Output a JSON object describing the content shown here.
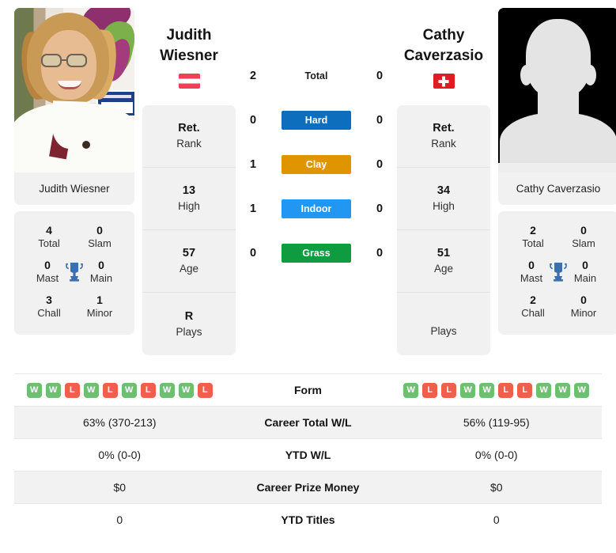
{
  "players": {
    "left": {
      "first_name": "Judith",
      "last_name": "Wiesner",
      "full_name": "Judith Wiesner",
      "flag": "austria-flag",
      "photo": "player-photo",
      "rank": {
        "rank_value": "Ret.",
        "rank_label": "Rank",
        "high_value": "13",
        "high_label": "High",
        "age_value": "57",
        "age_label": "Age",
        "plays_value": "R",
        "plays_label": "Plays"
      },
      "titles": {
        "total_value": "4",
        "total_label": "Total",
        "slam_value": "0",
        "slam_label": "Slam",
        "mast_value": "0",
        "mast_label": "Mast",
        "main_value": "0",
        "main_label": "Main",
        "chall_value": "3",
        "chall_label": "Chall",
        "minor_value": "1",
        "minor_label": "Minor"
      },
      "form": [
        "W",
        "W",
        "L",
        "W",
        "L",
        "W",
        "L",
        "W",
        "W",
        "L"
      ],
      "career_total_wl": "63% (370-213)",
      "ytd_wl": "0% (0-0)",
      "career_prize_money": "$0",
      "ytd_titles": "0"
    },
    "right": {
      "first_name": "Cathy",
      "last_name": "Caverzasio",
      "full_name": "Cathy Caverzasio",
      "flag": "switzerland-flag",
      "photo": "player-photo-placeholder",
      "rank": {
        "rank_value": "Ret.",
        "rank_label": "Rank",
        "high_value": "34",
        "high_label": "High",
        "age_value": "51",
        "age_label": "Age",
        "plays_value": "",
        "plays_label": "Plays"
      },
      "titles": {
        "total_value": "2",
        "total_label": "Total",
        "slam_value": "0",
        "slam_label": "Slam",
        "mast_value": "0",
        "mast_label": "Mast",
        "main_value": "0",
        "main_label": "Main",
        "chall_value": "2",
        "chall_label": "Chall",
        "minor_value": "0",
        "minor_label": "Minor"
      },
      "form": [
        "W",
        "L",
        "L",
        "W",
        "W",
        "L",
        "L",
        "W",
        "W",
        "W"
      ],
      "career_total_wl": "56% (119-95)",
      "ytd_wl": "0% (0-0)",
      "career_prize_money": "$0",
      "ytd_titles": "0"
    }
  },
  "head_to_head": {
    "rows": [
      {
        "label": "Total",
        "left": "2",
        "right": "0",
        "style": "plain",
        "color": ""
      },
      {
        "label": "Hard",
        "left": "0",
        "right": "0",
        "style": "pill",
        "color": "#0d6ebd"
      },
      {
        "label": "Clay",
        "left": "1",
        "right": "0",
        "style": "pill",
        "color": "#e09400"
      },
      {
        "label": "Indoor",
        "left": "1",
        "right": "0",
        "style": "pill",
        "color": "#2196f3"
      },
      {
        "label": "Grass",
        "left": "0",
        "right": "0",
        "style": "pill",
        "color": "#0f9b3f"
      }
    ]
  },
  "comparison_table": {
    "rows": [
      {
        "label": "Form",
        "type": "form"
      },
      {
        "label": "Career Total W/L",
        "type": "text",
        "left_key": "career_total_wl",
        "right_key": "career_total_wl"
      },
      {
        "label": "YTD W/L",
        "type": "text",
        "left_key": "ytd_wl",
        "right_key": "ytd_wl"
      },
      {
        "label": "Career Prize Money",
        "type": "text",
        "left_key": "career_prize_money",
        "right_key": "career_prize_money"
      },
      {
        "label": "YTD Titles",
        "type": "text",
        "left_key": "ytd_titles",
        "right_key": "ytd_titles"
      }
    ]
  },
  "colors": {
    "hard": "#0d6ebd",
    "clay": "#e09400",
    "indoor": "#2196f3",
    "grass": "#0f9b3f",
    "win_badge": "#6fbf73",
    "loss_badge": "#ef5f4e",
    "trophy": "#3a6fb0",
    "card_bg": "#f1f1f1",
    "alt_row_bg": "#f2f2f2"
  },
  "icons": {
    "trophy": "trophy-icon",
    "austria_flag": "austria-flag-icon",
    "switzerland_flag": "switzerland-flag-icon"
  }
}
